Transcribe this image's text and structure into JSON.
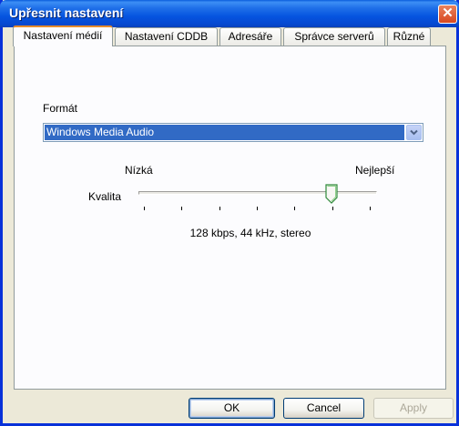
{
  "window": {
    "title": "Upřesnit nastavení",
    "close_glyph": "✕"
  },
  "tabs": [
    {
      "label": "Nastavení médií",
      "active": true
    },
    {
      "label": "Nastavení CDDB",
      "active": false
    },
    {
      "label": "Adresáře",
      "active": false
    },
    {
      "label": "Správce serverů",
      "active": false
    },
    {
      "label": "Různé",
      "active": false
    }
  ],
  "media": {
    "format_label": "Formát",
    "format_value": "Windows Media Audio",
    "quality_label": "Kvalita",
    "quality_low": "Nízká",
    "quality_high": "Nejlepší",
    "quality_level": 0.83,
    "quality_tick_count": 7,
    "status": "128 kbps, 44 kHz, stereo"
  },
  "buttons": {
    "ok": "OK",
    "cancel": "Cancel",
    "apply": "Apply"
  },
  "colors": {
    "titlebar": "#0554e0",
    "selection": "#316ac5",
    "tab_accent": "#e68b2c",
    "close": "#d84820"
  }
}
